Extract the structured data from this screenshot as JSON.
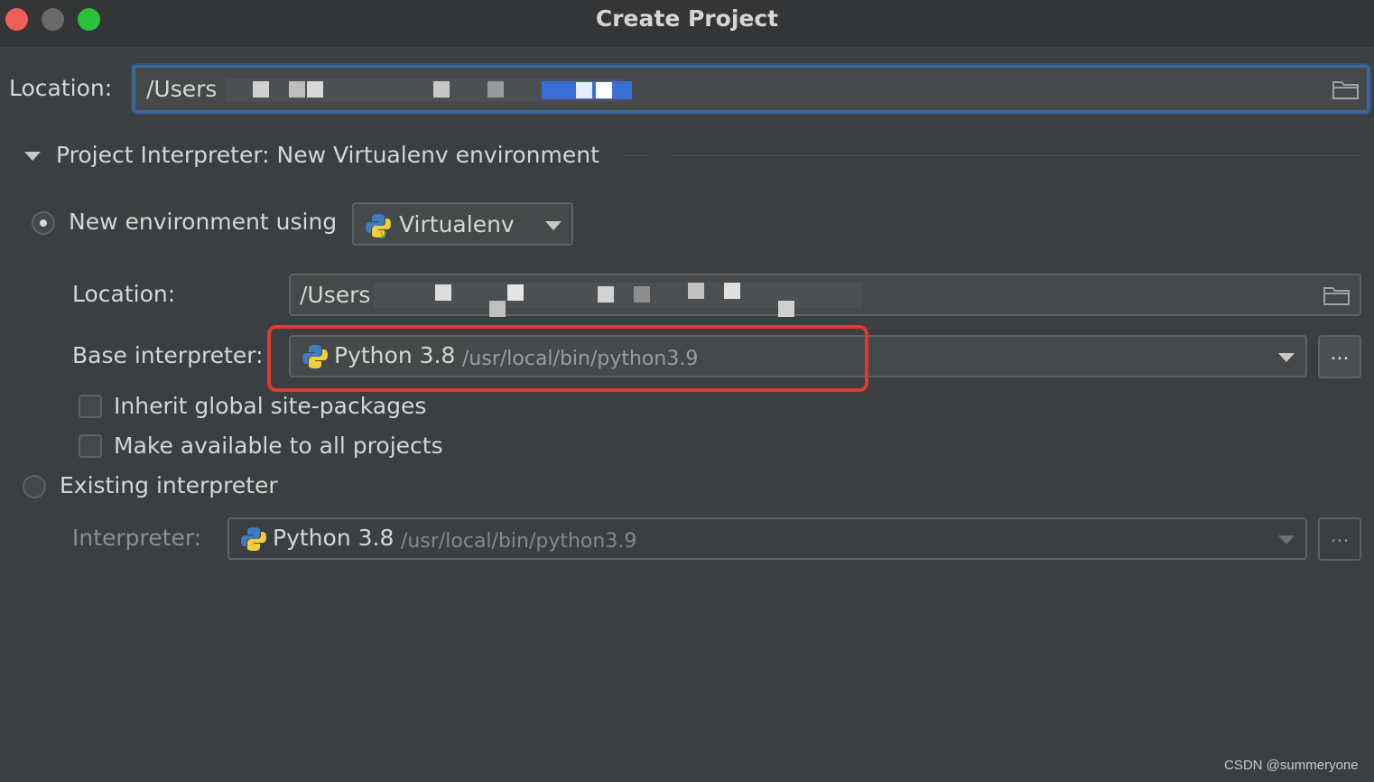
{
  "window": {
    "title": "Create Project",
    "traffic_lights": {
      "close_color": "#ee5f57",
      "minimize_color": "#6a6a6a",
      "zoom_color": "#2ec13c"
    }
  },
  "project_location": {
    "label": "Location:",
    "value": "/Users",
    "icon": "folder-icon"
  },
  "interpreter_section": {
    "header": "Project Interpreter: New Virtualenv environment",
    "expanded": true
  },
  "new_environment": {
    "radio_label": "New environment using",
    "selected": true,
    "tool": {
      "label": "Virtualenv",
      "icon": "python-virtualenv-icon"
    },
    "location": {
      "label": "Location:",
      "value": "/Users",
      "icon": "folder-icon"
    },
    "base_interpreter": {
      "label": "Base interpreter:",
      "name": "Python 3.8",
      "path": "/usr/local/bin/python3.9",
      "icon": "python-icon",
      "browse_label": "..."
    },
    "inherit_global": {
      "label": "Inherit global site-packages",
      "checked": false
    },
    "make_available": {
      "label": "Make available to all projects",
      "checked": false
    }
  },
  "existing_interpreter": {
    "radio_label": "Existing interpreter",
    "selected": false,
    "interpreter": {
      "label": "Interpreter:",
      "name": "Python 3.8",
      "path": "/usr/local/bin/python3.9",
      "icon": "python-icon",
      "browse_label": "..."
    }
  },
  "annotation": {
    "highlight_color": "#e03a2f"
  },
  "watermark": "CSDN @summeryone"
}
